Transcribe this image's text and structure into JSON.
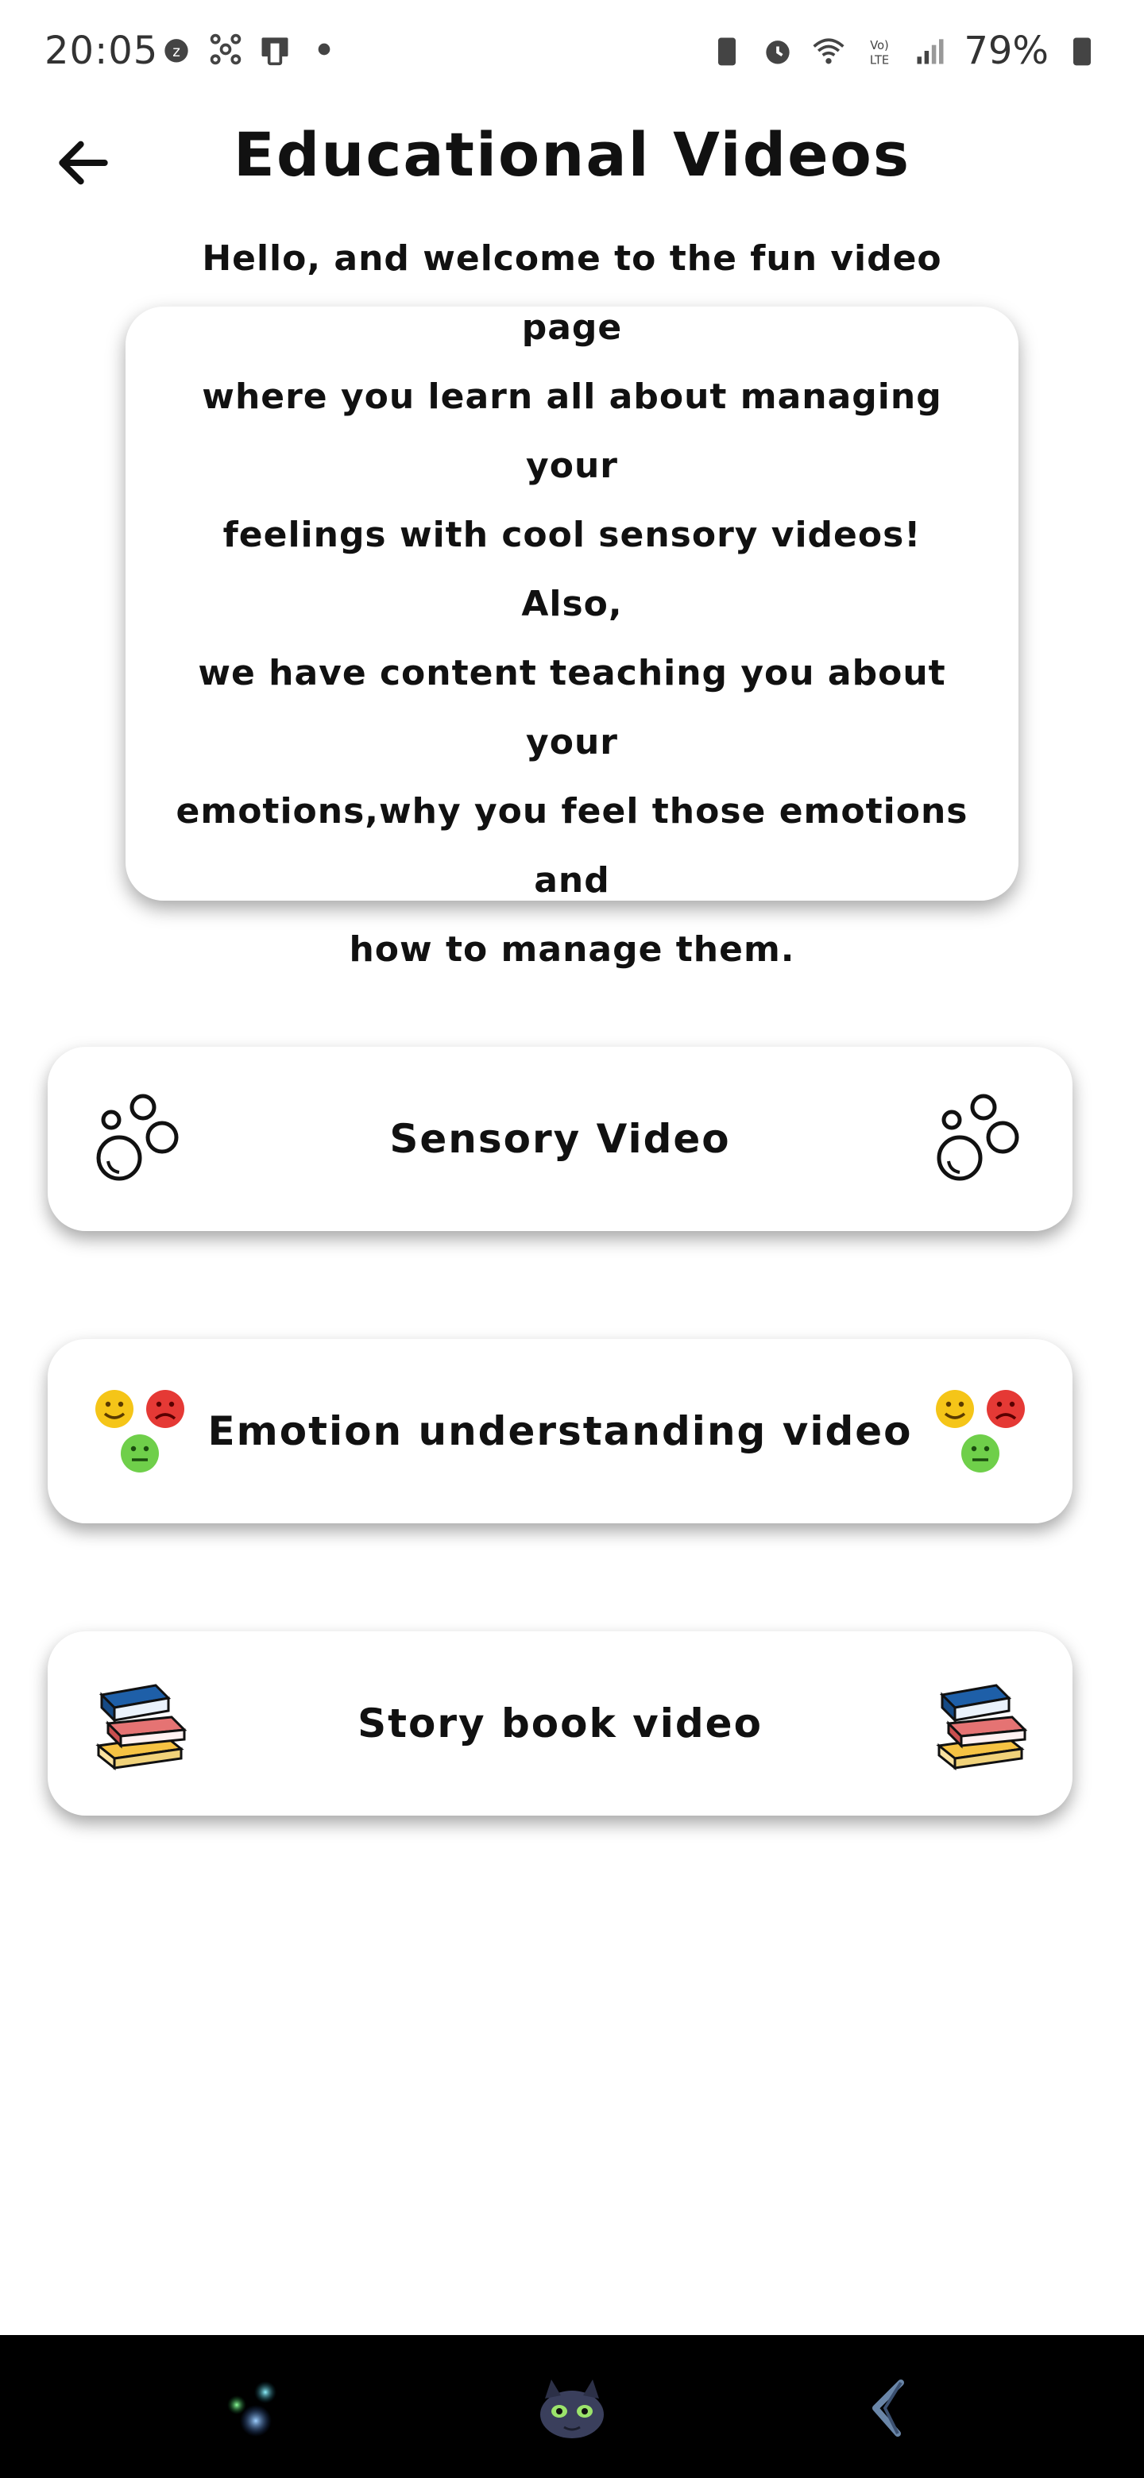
{
  "status_bar": {
    "time": "20:05",
    "battery": "79%"
  },
  "header": {
    "title": "Educational Videos",
    "back_icon": "arrow-left-icon"
  },
  "intro": {
    "lines": [
      "Hello, and welcome to the fun video page",
      "where you learn all about managing your",
      "feelings with cool sensory videos! Also,",
      "we have content teaching you about your",
      "emotions,why you feel those emotions and",
      "how to manage them."
    ]
  },
  "options": [
    {
      "label": "Sensory Video",
      "icon": "bubbles-icon"
    },
    {
      "label": "Emotion understanding video",
      "icon": "emotion-faces-icon"
    },
    {
      "label": "Story book video",
      "icon": "books-stack-icon"
    }
  ],
  "colors": {
    "background": "#ffffff",
    "nav_bar": "#000000",
    "happy_face": "#f5c518",
    "sad_face": "#e53935",
    "neutral_face": "#6fcf4a",
    "book_blue": "#1e5fa8",
    "book_red": "#e57373",
    "book_yellow": "#f6c343"
  }
}
